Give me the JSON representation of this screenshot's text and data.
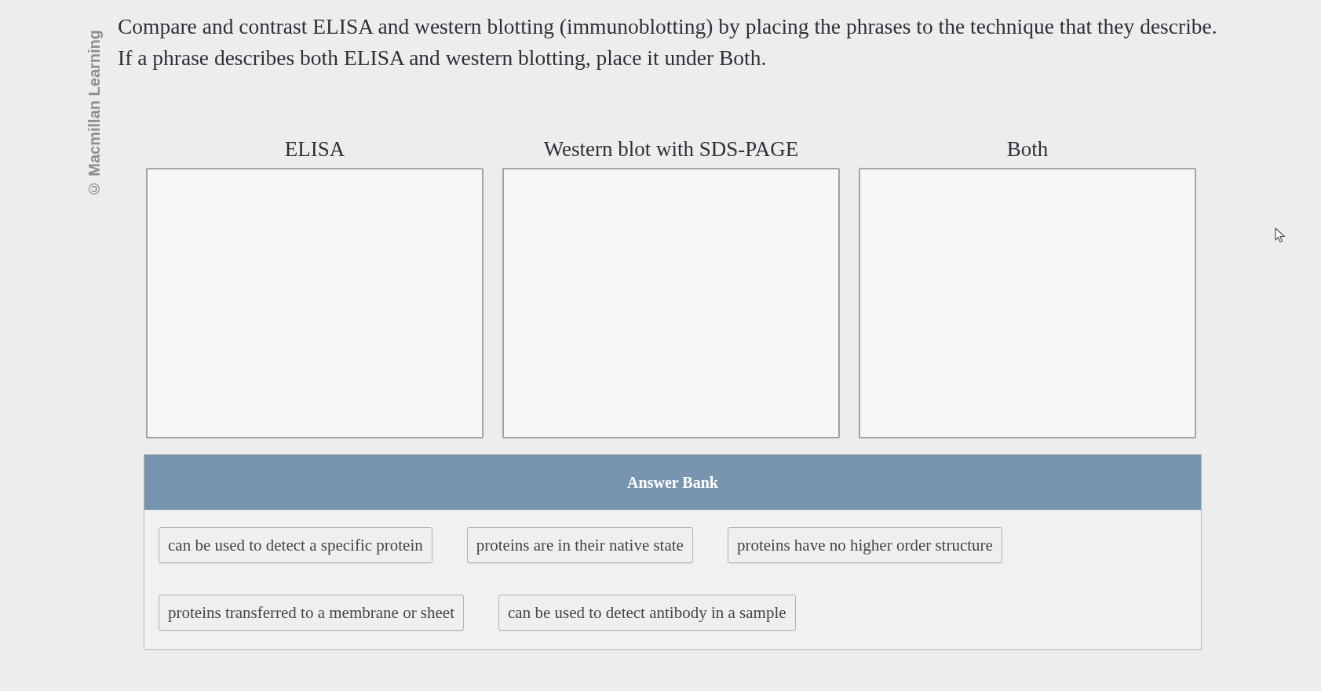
{
  "copyright_notice": "© Macmillan Learning",
  "instructions": "Compare and contrast ELISA and western blotting (immunoblotting) by placing the phrases to the technique that they describe. If a phrase describes both ELISA and western blotting, place it under Both.",
  "drop_zones": [
    {
      "label": "ELISA"
    },
    {
      "label": "Western blot with SDS-PAGE"
    },
    {
      "label": "Both"
    }
  ],
  "answer_bank": {
    "title": "Answer Bank",
    "phrases": [
      "can be used to detect a specific protein",
      "proteins are in their native state",
      "proteins have no higher order structure",
      "proteins transferred to a membrane or sheet",
      "can be used to detect antibody in a sample"
    ]
  }
}
